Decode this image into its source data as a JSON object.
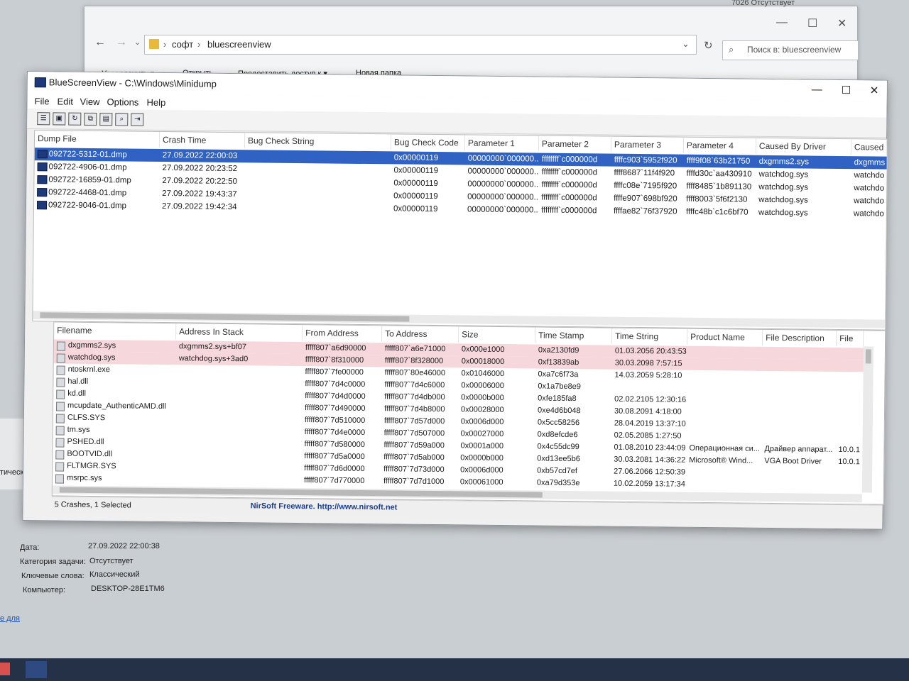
{
  "explorer": {
    "breadcrumb": [
      "софт",
      "bluescreenview"
    ],
    "search_placeholder": "Поиск в: bluescreenview",
    "menu": [
      "Упорядочить ▾",
      "Открыть",
      "Предоставить доступ к ▾",
      "Новая папка"
    ]
  },
  "background_top_right": "7026   Отсутствует",
  "window": {
    "title": "BlueScreenView  -  C:\\Windows\\Minidump",
    "min": "—",
    "max": "☐",
    "close": "✕"
  },
  "menu": [
    "File",
    "Edit",
    "View",
    "Options",
    "Help"
  ],
  "toolbar_icons": [
    "properties-icon",
    "save-icon",
    "refresh-icon",
    "copy-icon",
    "html-report-icon",
    "find-icon",
    "exit-icon"
  ],
  "upper_table": {
    "columns": [
      "Dump File",
      "Crash Time",
      "Bug Check String",
      "Bug Check Code",
      "Parameter 1",
      "Parameter 2",
      "Parameter 3",
      "Parameter 4",
      "Caused By Driver",
      "Caused B"
    ],
    "rows": [
      {
        "file": "092722-5312-01.dmp",
        "time": "27.09.2022 22:00:03",
        "bcstr": "",
        "code": "0x00000119",
        "p1": "00000000`000000...",
        "p2": "ffffffff`c000000d",
        "p3": "ffffc903`5952f920",
        "p4": "ffff9f08`63b21750",
        "driver": "dxgmms2.sys",
        "caused": "dxgmms"
      },
      {
        "file": "092722-4906-01.dmp",
        "time": "27.09.2022 20:23:52",
        "bcstr": "",
        "code": "0x00000119",
        "p1": "00000000`000000...",
        "p2": "ffffffff`c000000d",
        "p3": "ffff8687`11f4f920",
        "p4": "ffffd30c`aa430910",
        "driver": "watchdog.sys",
        "caused": "watchdo"
      },
      {
        "file": "092722-16859-01.dmp",
        "time": "27.09.2022 20:22:50",
        "bcstr": "",
        "code": "0x00000119",
        "p1": "00000000`000000...",
        "p2": "ffffffff`c000000d",
        "p3": "ffffc08e`7195f920",
        "p4": "ffff8485`1b891130",
        "driver": "watchdog.sys",
        "caused": "watchdo"
      },
      {
        "file": "092722-4468-01.dmp",
        "time": "27.09.2022 19:43:37",
        "bcstr": "",
        "code": "0x00000119",
        "p1": "00000000`000000...",
        "p2": "ffffffff`c000000d",
        "p3": "ffffe907`698bf920",
        "p4": "ffff8003`5f6f2130",
        "driver": "watchdog.sys",
        "caused": "watchdo"
      },
      {
        "file": "092722-9046-01.dmp",
        "time": "27.09.2022 19:42:34",
        "bcstr": "",
        "code": "0x00000119",
        "p1": "00000000`000000...",
        "p2": "ffffffff`c000000d",
        "p3": "ffffae82`76f37920",
        "p4": "ffffc48b`c1c6bf70",
        "driver": "watchdog.sys",
        "caused": "watchdo"
      }
    ]
  },
  "lower_table": {
    "columns": [
      "Filename",
      "Address In Stack",
      "From Address",
      "To Address",
      "Size",
      "Time Stamp",
      "Time String",
      "Product Name",
      "File Description",
      "File Ve"
    ],
    "rows": [
      {
        "name": "dxgmms2.sys",
        "stack": "dxgmms2.sys+bf07",
        "from": "fffff807`a6d90000",
        "to": "fffff807`a6e71000",
        "size": "0x000e1000",
        "ts": "0xa2130fd9",
        "tstr": "01.03.2056 20:43:53",
        "prod": "",
        "desc": "",
        "ver": "",
        "pink": true
      },
      {
        "name": "watchdog.sys",
        "stack": "watchdog.sys+3ad0",
        "from": "fffff807`8f310000",
        "to": "fffff807`8f328000",
        "size": "0x00018000",
        "ts": "0xf13839ab",
        "tstr": "30.03.2098 7:57:15",
        "prod": "",
        "desc": "",
        "ver": "",
        "pink": true
      },
      {
        "name": "ntoskrnl.exe",
        "stack": "",
        "from": "fffff807`7fe00000",
        "to": "fffff807`80e46000",
        "size": "0x01046000",
        "ts": "0xa7c6f73a",
        "tstr": "14.03.2059 5:28:10",
        "prod": "",
        "desc": "",
        "ver": "",
        "pink": false
      },
      {
        "name": "hal.dll",
        "stack": "",
        "from": "fffff807`7d4c0000",
        "to": "fffff807`7d4c6000",
        "size": "0x00006000",
        "ts": "0x1a7be8e9",
        "tstr": "",
        "prod": "",
        "desc": "",
        "ver": "",
        "pink": false
      },
      {
        "name": "kd.dll",
        "stack": "",
        "from": "fffff807`7d4d0000",
        "to": "fffff807`7d4db000",
        "size": "0x0000b000",
        "ts": "0xfe185fa8",
        "tstr": "02.02.2105 12:30:16",
        "prod": "",
        "desc": "",
        "ver": "",
        "pink": false
      },
      {
        "name": "mcupdate_AuthenticAMD.dll",
        "stack": "",
        "from": "fffff807`7d490000",
        "to": "fffff807`7d4b8000",
        "size": "0x00028000",
        "ts": "0xe4d6b048",
        "tstr": "30.08.2091 4:18:00",
        "prod": "",
        "desc": "",
        "ver": "",
        "pink": false
      },
      {
        "name": "CLFS.SYS",
        "stack": "",
        "from": "fffff807`7d510000",
        "to": "fffff807`7d57d000",
        "size": "0x0006d000",
        "ts": "0x5cc58256",
        "tstr": "28.04.2019 13:37:10",
        "prod": "",
        "desc": "",
        "ver": "",
        "pink": false
      },
      {
        "name": "tm.sys",
        "stack": "",
        "from": "fffff807`7d4e0000",
        "to": "fffff807`7d507000",
        "size": "0x00027000",
        "ts": "0xd8efcde6",
        "tstr": "02.05.2085 1:27:50",
        "prod": "",
        "desc": "",
        "ver": "",
        "pink": false
      },
      {
        "name": "PSHED.dll",
        "stack": "",
        "from": "fffff807`7d580000",
        "to": "fffff807`7d59a000",
        "size": "0x0001a000",
        "ts": "0x4c55dc99",
        "tstr": "01.08.2010 23:44:09",
        "prod": "Операционная си...",
        "desc": "Драйвер аппарат...",
        "ver": "10.0.1",
        "pink": false
      },
      {
        "name": "BOOTVID.dll",
        "stack": "",
        "from": "fffff807`7d5a0000",
        "to": "fffff807`7d5ab000",
        "size": "0x0000b000",
        "ts": "0xd13ee5b6",
        "tstr": "30.03.2081 14:36:22",
        "prod": "Microsoft® Wind...",
        "desc": "VGA Boot Driver",
        "ver": "10.0.1",
        "pink": false
      },
      {
        "name": "FLTMGR.SYS",
        "stack": "",
        "from": "fffff807`7d6d0000",
        "to": "fffff807`7d73d000",
        "size": "0x0006d000",
        "ts": "0xb57cd7ef",
        "tstr": "27.06.2066 12:50:39",
        "prod": "",
        "desc": "",
        "ver": "",
        "pink": false
      },
      {
        "name": "msrpc.sys",
        "stack": "",
        "from": "fffff807`7d770000",
        "to": "fffff807`7d7d1000",
        "size": "0x00061000",
        "ts": "0xa79d353e",
        "tstr": "10.02.2059 13:17:34",
        "prod": "",
        "desc": "",
        "ver": "",
        "pink": false
      }
    ]
  },
  "status": {
    "left": "5 Crashes, 1 Selected",
    "center": "NirSoft Freeware.  http://www.nirsoft.net"
  },
  "event": {
    "date_label": "Дата:",
    "date_value": "27.09.2022 22:00:38",
    "cat_label": "Категория задачи:",
    "cat_value": "Отсутствует",
    "kw_label": "Ключевые слова:",
    "kw_value": "Классический",
    "pc_label": "Компьютер:",
    "pc_value": "DESKTOP-28E1TM6",
    "side_text": "тической ошибк",
    "link_text": "е для"
  }
}
